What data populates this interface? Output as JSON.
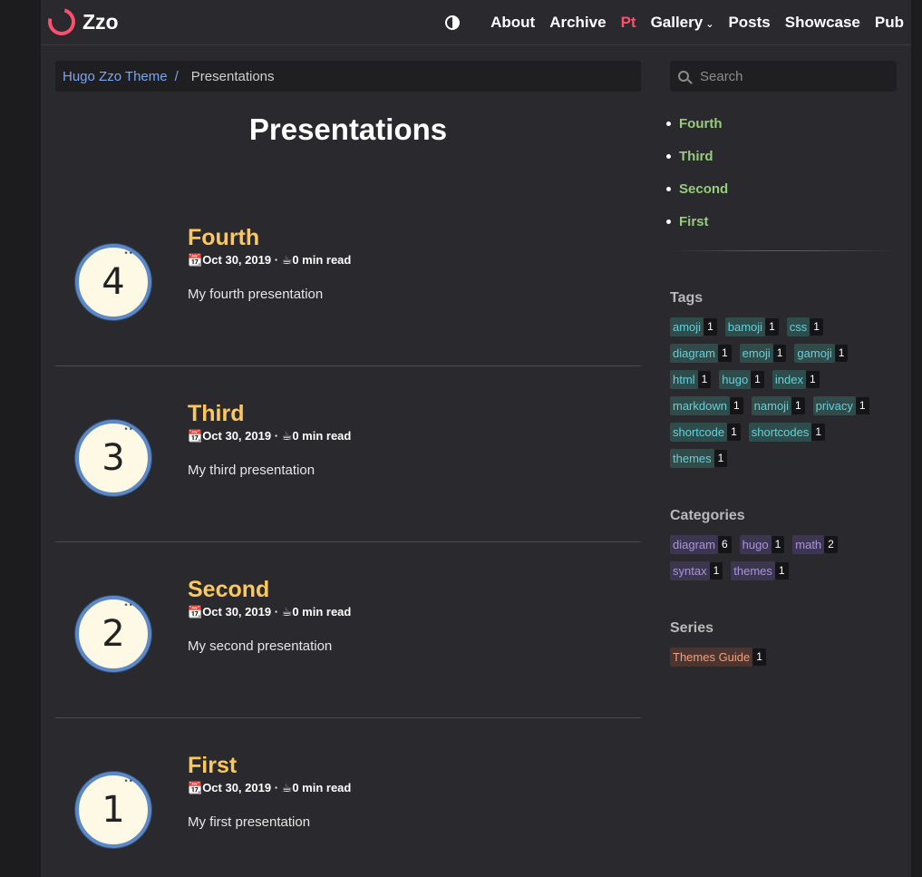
{
  "colors": {
    "accent": "#ff4f6d",
    "post_title": "#fcc75b",
    "toc_link": "#96cc7d",
    "link": "#79a7ef"
  },
  "header": {
    "logo_text": "Zzo",
    "theme_toggle_icon": "contrast-icon",
    "nav": [
      {
        "label": "About"
      },
      {
        "label": "Archive"
      },
      {
        "label": "Pt",
        "active": true
      },
      {
        "label": "Gallery",
        "dropdown": true
      },
      {
        "label": "Posts"
      },
      {
        "label": "Showcase"
      },
      {
        "label": "Pub"
      }
    ]
  },
  "breadcrumb": {
    "home": "Hugo Zzo Theme",
    "separator": "/",
    "current": "Presentations"
  },
  "page_title": "Presentations",
  "posts": [
    {
      "badge": "4",
      "title": "Fourth",
      "date": "Oct 30, 2019",
      "read_time": "0 min read",
      "description": "My fourth presentation"
    },
    {
      "badge": "3",
      "title": "Third",
      "date": "Oct 30, 2019",
      "read_time": "0 min read",
      "description": "My third presentation"
    },
    {
      "badge": "2",
      "title": "Second",
      "date": "Oct 30, 2019",
      "read_time": "0 min read",
      "description": "My second presentation"
    },
    {
      "badge": "1",
      "title": "First",
      "date": "Oct 30, 2019",
      "read_time": "0 min read",
      "description": "My first presentation"
    }
  ],
  "meta_separator": "·",
  "search": {
    "placeholder": "Search"
  },
  "toc": [
    {
      "label": "Fourth"
    },
    {
      "label": "Third"
    },
    {
      "label": "Second"
    },
    {
      "label": "First"
    }
  ],
  "tags": {
    "heading": "Tags",
    "items": [
      {
        "name": "amoji",
        "count": "1"
      },
      {
        "name": "bamoji",
        "count": "1"
      },
      {
        "name": "css",
        "count": "1"
      },
      {
        "name": "diagram",
        "count": "1"
      },
      {
        "name": "emoji",
        "count": "1"
      },
      {
        "name": "gamoji",
        "count": "1"
      },
      {
        "name": "html",
        "count": "1"
      },
      {
        "name": "hugo",
        "count": "1"
      },
      {
        "name": "index",
        "count": "1"
      },
      {
        "name": "markdown",
        "count": "1"
      },
      {
        "name": "namoji",
        "count": "1"
      },
      {
        "name": "privacy",
        "count": "1"
      },
      {
        "name": "shortcode",
        "count": "1"
      },
      {
        "name": "shortcodes",
        "count": "1"
      },
      {
        "name": "themes",
        "count": "1"
      }
    ]
  },
  "categories": {
    "heading": "Categories",
    "items": [
      {
        "name": "diagram",
        "count": "6"
      },
      {
        "name": "hugo",
        "count": "1"
      },
      {
        "name": "math",
        "count": "2"
      },
      {
        "name": "syntax",
        "count": "1"
      },
      {
        "name": "themes",
        "count": "1"
      }
    ]
  },
  "series": {
    "heading": "Series",
    "items": [
      {
        "name": "Themes Guide",
        "count": "1"
      }
    ]
  }
}
